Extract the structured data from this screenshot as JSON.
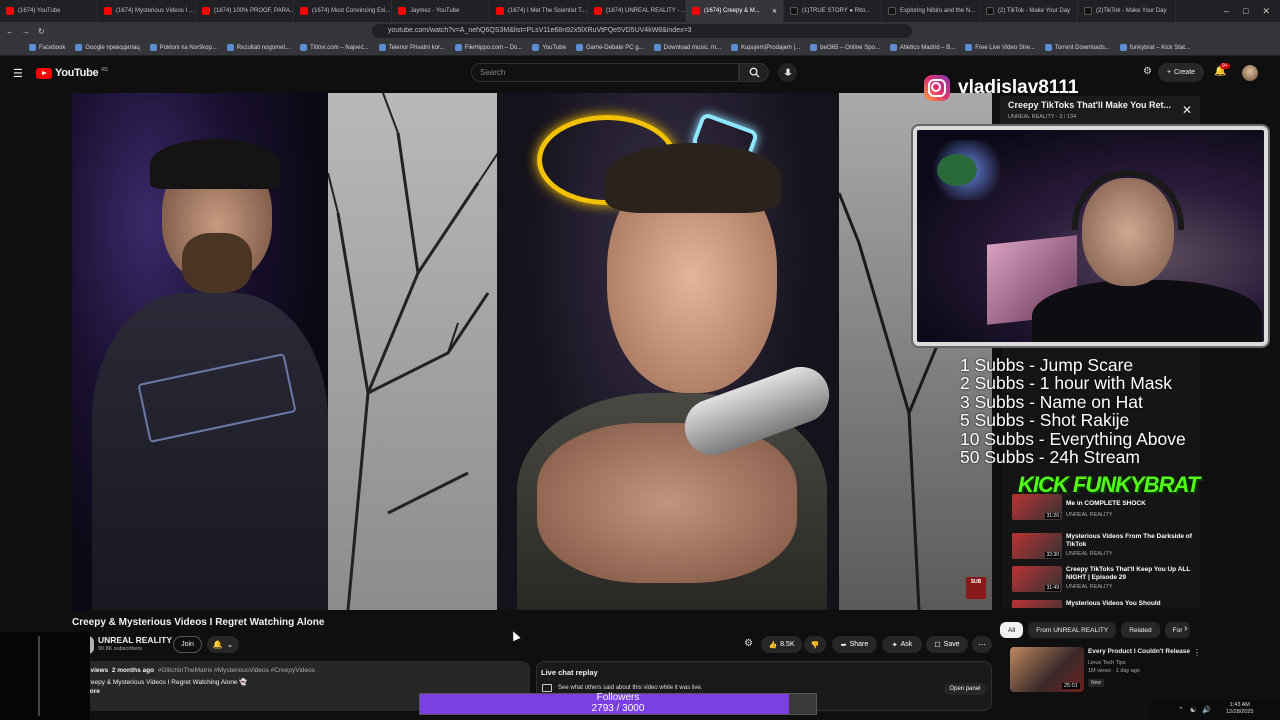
{
  "browser": {
    "tabs": [
      {
        "label": "(1674) YouTube",
        "icon": "youtube-icon",
        "active": false
      },
      {
        "label": "(1674) Mysterious Videos I ...",
        "icon": "youtube-icon",
        "active": false
      },
      {
        "label": "(1674) 100% PROOF, PARA...",
        "icon": "youtube-icon",
        "active": false
      },
      {
        "label": "(1674) Most Convincing Exi...",
        "icon": "youtube-icon",
        "active": false
      },
      {
        "label": "Jaymez - YouTube",
        "icon": "youtube-icon",
        "active": false
      },
      {
        "label": "(1674) I Met The Scientist T...",
        "icon": "youtube-icon",
        "active": false
      },
      {
        "label": "(1674) UNREAL REALITY - ...",
        "icon": "youtube-icon",
        "active": false
      },
      {
        "label": "(1674) Creepy & M...",
        "icon": "youtube-icon",
        "active": true
      },
      {
        "label": "(1)TRUE STORY ● Rito...",
        "icon": "tiktok-icon",
        "active": false
      },
      {
        "label": "Exploring Nibiru and the N...",
        "icon": "tiktok-icon",
        "active": false
      },
      {
        "label": "(2) TikTok - Make Your Day",
        "icon": "tiktok-icon",
        "active": false
      },
      {
        "label": "(2)TikTok - Make Your Day",
        "icon": "tiktok-icon",
        "active": false
      }
    ],
    "url": "youtube.com/watch?v=A_nehQ6QS3M&list=PLsV11e68n92x5lXRuVtPQe5VD5UV4kW8&index=3",
    "bookmarks": [
      "Facebook",
      "Google преводилац",
      "Pokloni na Norškop...",
      "Rezultati nogomet...",
      "Titlovi.com – Najveć...",
      "Telenor Privatni kor...",
      "FileHippo.com – Do...",
      "YouTube",
      "Game-Debate PC g...",
      "Download music, m...",
      "Kupujem|Prodajem |...",
      "bet365 – Online Spo...",
      "Atletico Madrid – B...",
      "Free Live Video Stre...",
      "Torrent Downloads...",
      "funkybrat – Kick Stat..."
    ]
  },
  "youtube": {
    "logo_text": "YouTube",
    "logo_region": "RS",
    "search_placeholder": "Search",
    "create_label": "Create",
    "notif_badge": "9+"
  },
  "overlay": {
    "instagram_handle": "vladislav8111",
    "goals": [
      "1 Subbs - Jump Scare",
      "2 Subbs - 1 hour with Mask",
      "3 Subbs - Name on Hat",
      "5 Subbs - Shot Rakije",
      "10 Subbs - Everything Above",
      "50 Subbs - 24h Stream"
    ],
    "kick_logo": "KICK FUNKYBRAT",
    "followers_label": "Followers",
    "followers_count": "2793 / 3000",
    "followers_progress": 0.931
  },
  "playlist": {
    "title": "Creepy TikToks That'll Make You Ret...",
    "subtitle": "UNREAL REALITY - 3 / 134",
    "items": [
      {
        "title": "Me in COMPLETE SHOCK",
        "channel": "UNREAL REALITY",
        "duration": "31:26"
      },
      {
        "title": "Mysterious Videos From The Darkside of TikTok",
        "channel": "UNREAL REALITY",
        "duration": "32:30"
      },
      {
        "title": "Creepy TikToks That'll Keep You Up ALL NIGHT | Episode 29",
        "channel": "UNREAL REALITY",
        "duration": "31:49"
      },
      {
        "title": "Mysterious Videos You Should",
        "channel": "",
        "duration": ""
      }
    ]
  },
  "video": {
    "title": "Creepy & Mysterious Videos I Regret Watching Alone",
    "channel_name": "UNREAL REALITY",
    "subscribers": "90.8K subscribers",
    "join_label": "Join",
    "like_count": "8.5K",
    "share_label": "Share",
    "ask_label": "Ask",
    "save_label": "Save",
    "views": "K views",
    "age": "2 months ago",
    "hashtags": "#GlitchInTheMatrix #MysteriousVideos #CreepyVideos",
    "desc_line": "Creepy & Mysterious Videos I Regret Watching Alone 👻",
    "more_label": "more",
    "sub_badge": "SUB"
  },
  "chat": {
    "title": "Live chat replay",
    "desc": "See what others said about this video while it was live.",
    "open_panel": "Open panel"
  },
  "chips": [
    "All",
    "From UNREAL REALITY",
    "Related",
    "For"
  ],
  "recommended": {
    "title": "Every Product I Couldn't Release",
    "channel": "Linus Tech Tips",
    "meta": "1M views · 1 day ago",
    "badge": "New",
    "duration": "25:01"
  },
  "taskbar": {
    "time": "1:43 AM",
    "date": "12/28/2025"
  }
}
